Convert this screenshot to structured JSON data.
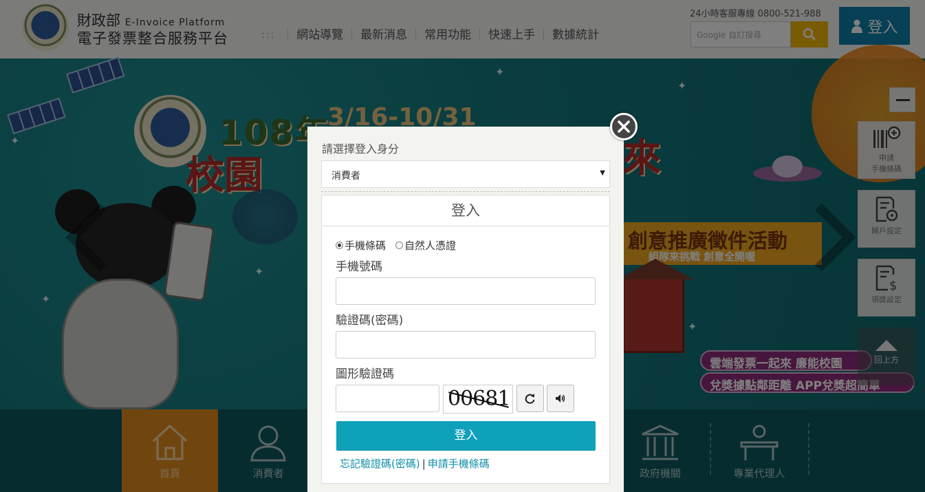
{
  "header": {
    "org_name": "財政部",
    "platform_en": "E-Invoice Platform",
    "platform_zh": "電子發票整合服務平台",
    "nav_dots": ":::",
    "nav": [
      "網站導覽",
      "最新消息",
      "常用功能",
      "快速上手",
      "數據統計"
    ],
    "hotline": "24小時客服專線 0800-521-988",
    "search_placeholder": "Google 自訂搜尋",
    "login_label": "登入"
  },
  "banner": {
    "year": "108年",
    "dates": "3/16-10/31",
    "title_left": "校園",
    "title_right": "來",
    "ribbon": "創意推廣徵件活動",
    "ribbon_sub": "組隊來挑戰 創意全開喔",
    "tag1": "雲端發票一起來 廉能校園",
    "tag2": "兌獎據點鄰距離 APP兌獎超簡單"
  },
  "bottom_nav": [
    {
      "label": "首頁",
      "icon": "home-icon"
    },
    {
      "label": "消費者",
      "icon": "person-icon"
    },
    {
      "label": "政府機關",
      "icon": "government-icon"
    },
    {
      "label": "專業代理人",
      "icon": "desk-icon"
    }
  ],
  "tools": [
    {
      "label1": "申請",
      "label2": "手機條碼",
      "icon": "barcode-add-icon"
    },
    {
      "label1": "歸戶設定",
      "label2": "",
      "icon": "settings-doc-icon"
    },
    {
      "label1": "領獎設定",
      "label2": "",
      "icon": "money-doc-icon"
    }
  ],
  "back_to_top": "回上方",
  "modal": {
    "role_label": "請選擇登入身分",
    "role_value": "消費者",
    "panel_title": "登入",
    "radio_mobile": "手機條碼",
    "radio_citizen": "自然人憑證",
    "phone_label": "手機號碼",
    "password_label": "驗證碼(密碼)",
    "captcha_label": "圖形驗證碼",
    "captcha_text": "00681",
    "submit_label": "登入",
    "forgot_link": "忘記驗證碼(密碼)",
    "link_sep": "|",
    "apply_link": "申請手機條碼"
  },
  "colors": {
    "accent": "#0fa0ba",
    "login_blue": "#0f7fa8",
    "search_yellow": "#f2b705",
    "active_orange": "#e38d1d"
  }
}
